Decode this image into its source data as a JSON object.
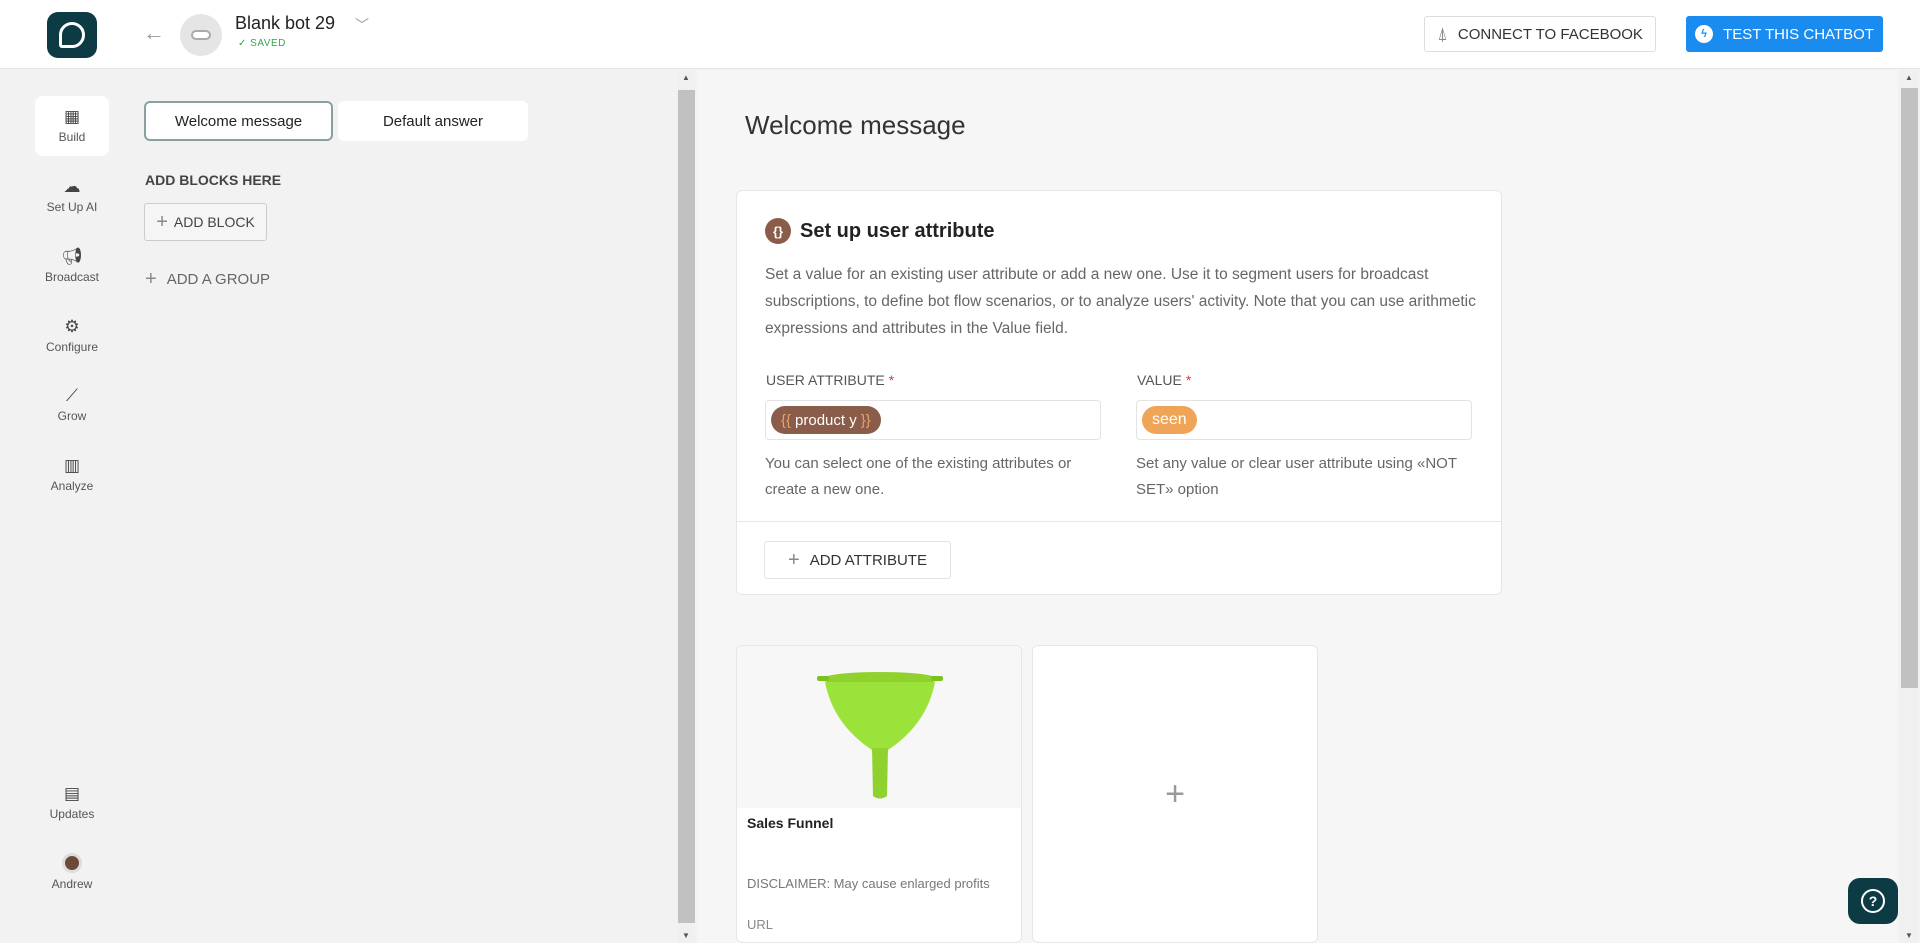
{
  "header": {
    "bot_name": "Blank bot 29",
    "saved_label": "SAVED",
    "connect_label": "CONNECT TO FACEBOOK",
    "test_label": "TEST THIS CHATBOT"
  },
  "nav": {
    "build": "Build",
    "setup_ai": "Set Up AI",
    "broadcast": "Broadcast",
    "configure": "Configure",
    "grow": "Grow",
    "analyze": "Analyze",
    "updates": "Updates",
    "user": "Andrew"
  },
  "groups": {
    "tab_welcome": "Welcome message",
    "tab_default": "Default answer",
    "add_blocks_here": "ADD BLOCKS HERE",
    "add_block": "ADD BLOCK",
    "add_group": "ADD A GROUP"
  },
  "main": {
    "title": "Welcome message",
    "card": {
      "title": "Set up user attribute",
      "description": "Set a value for an existing user attribute or add a new one. Use it to segment users for broadcast subscriptions, to define bot flow scenarios, or to analyze users' activity. Note that you can use arithmetic expressions and attributes in the Value field.",
      "attr_label": "USER ATTRIBUTE",
      "value_label": "VALUE",
      "required_mark": "*",
      "attr_value": "product y",
      "value_value": "seen",
      "attr_hint": "You can select one of the existing attributes or create a new one.",
      "value_hint": "Set any value or clear user attribute using «NOT SET» option",
      "add_attribute": "ADD ATTRIBUTE"
    },
    "gallery": {
      "title": "Sales Funnel",
      "subtitle": "DISCLAIMER: May cause enlarged profits",
      "url_label": "URL"
    }
  },
  "colors": {
    "brand_dark": "#0d3b44",
    "primary_blue": "#1a8cf0",
    "attr_pill": "#8a5c4a",
    "value_pill": "#f0a457",
    "saved_green": "#2fa84f"
  }
}
